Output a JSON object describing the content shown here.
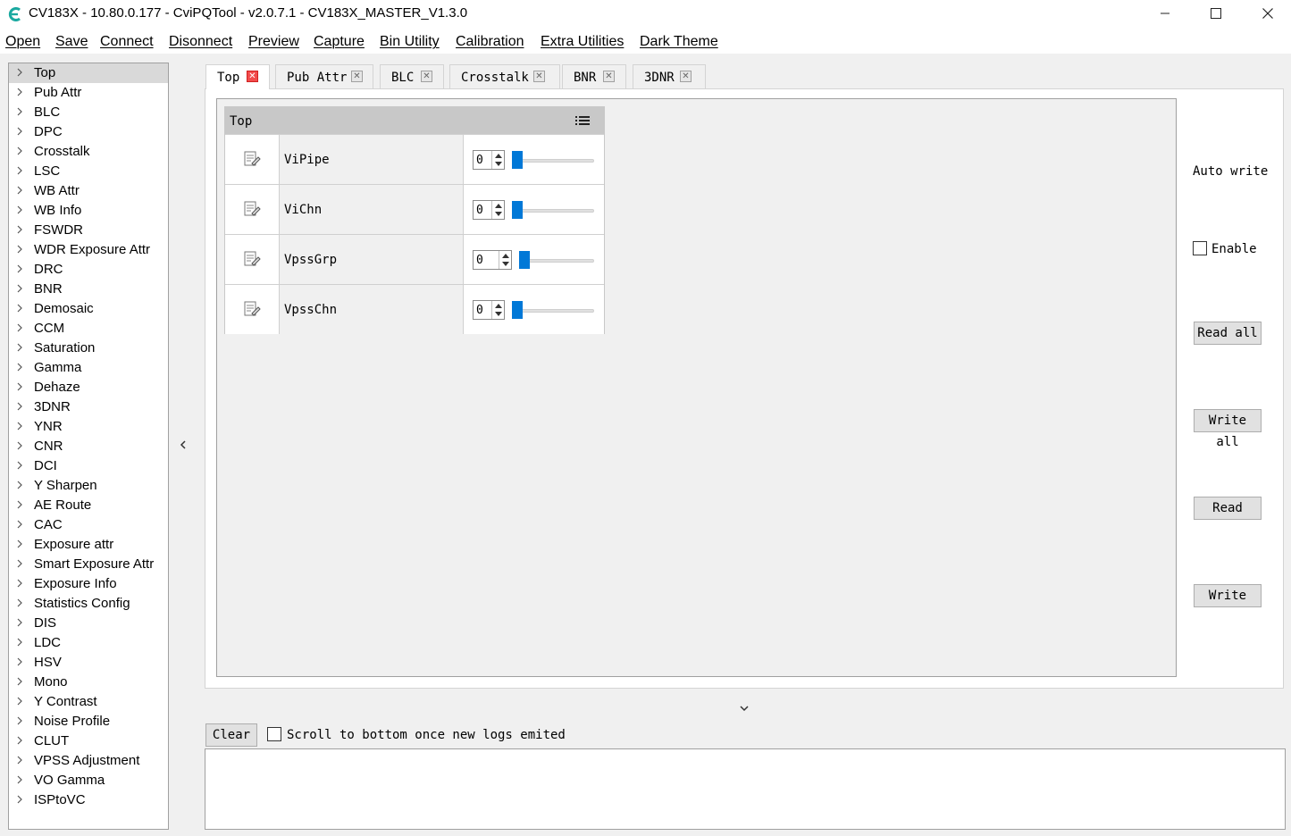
{
  "window": {
    "title": "CV183X - 10.80.0.177 - CviPQTool - v2.0.7.1 - CV183X_MASTER_V1.3.0",
    "app_icon": "cvitek-logo-icon",
    "accent_color": "#0078d7"
  },
  "menu": {
    "items": [
      "Open",
      "Save",
      "Connect",
      "Disonnect",
      "Preview",
      "Capture",
      "Bin Utility",
      "Calibration",
      "Extra Utilities",
      "Dark Theme"
    ]
  },
  "sidebar": {
    "selected": "Top",
    "items": [
      "Top",
      "Pub Attr",
      "BLC",
      "DPC",
      "Crosstalk",
      "LSC",
      "WB Attr",
      "WB Info",
      "FSWDR",
      "WDR Exposure Attr",
      "DRC",
      "BNR",
      "Demosaic",
      "CCM",
      "Saturation",
      "Gamma",
      "Dehaze",
      "3DNR",
      "YNR",
      "CNR",
      "DCI",
      "Y Sharpen",
      "AE Route",
      "CAC",
      "Exposure attr",
      "Smart Exposure Attr",
      "Exposure Info",
      "Statistics Config",
      "DIS",
      "LDC",
      "HSV",
      "Mono",
      "Y Contrast",
      "Noise Profile",
      "CLUT",
      "VPSS Adjustment",
      "VO Gamma",
      "ISPtoVC"
    ]
  },
  "tabs": [
    "Top",
    "Pub Attr",
    "BLC",
    "Crosstalk",
    "BNR",
    "3DNR"
  ],
  "active_tab": "Top",
  "params": {
    "title": "Top",
    "rows": [
      {
        "name": "ViPipe",
        "value": "0",
        "slider_fraction": 0.0
      },
      {
        "name": "ViChn",
        "value": "0",
        "slider_fraction": 0.0
      },
      {
        "name": "VpssGrp",
        "value": "0",
        "slider_fraction": 0.0
      },
      {
        "name": "VpssChn",
        "value": "0",
        "slider_fraction": 0.0
      }
    ]
  },
  "controls": {
    "auto_write": "Auto write",
    "enable": "Enable",
    "enable_checked": false,
    "read_all": "Read all",
    "write_all": "Write all",
    "read": "Read",
    "write": "Write"
  },
  "log": {
    "clear": "Clear",
    "scroll_label": "Scroll to bottom once new logs emited",
    "scroll_checked": false,
    "text": ""
  }
}
